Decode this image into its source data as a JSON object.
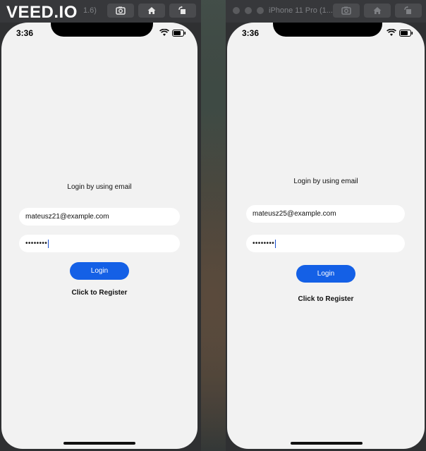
{
  "watermark": "VEED.IO",
  "left_device": {
    "window_title_fragment": "1.6)",
    "time": "3:36",
    "heading": "Login by using email",
    "email_value": "mateusz21@example.com",
    "password_value": "••••••••",
    "login_label": "Login",
    "register_label": "Click to Register"
  },
  "right_device": {
    "window_title": "iPhone 11 Pro (1...",
    "time": "3:36",
    "heading": "Login by using email",
    "email_value": "mateusz25@example.com",
    "password_value": "••••••••",
    "login_label": "Login",
    "register_label": "Click to Register"
  },
  "toolbar_icons": [
    "screenshot-icon",
    "home-icon",
    "rotate-icon"
  ],
  "colors": {
    "accent": "#1460e6",
    "screen_bg": "#f2f2f2",
    "field_bg": "#ffffff"
  }
}
